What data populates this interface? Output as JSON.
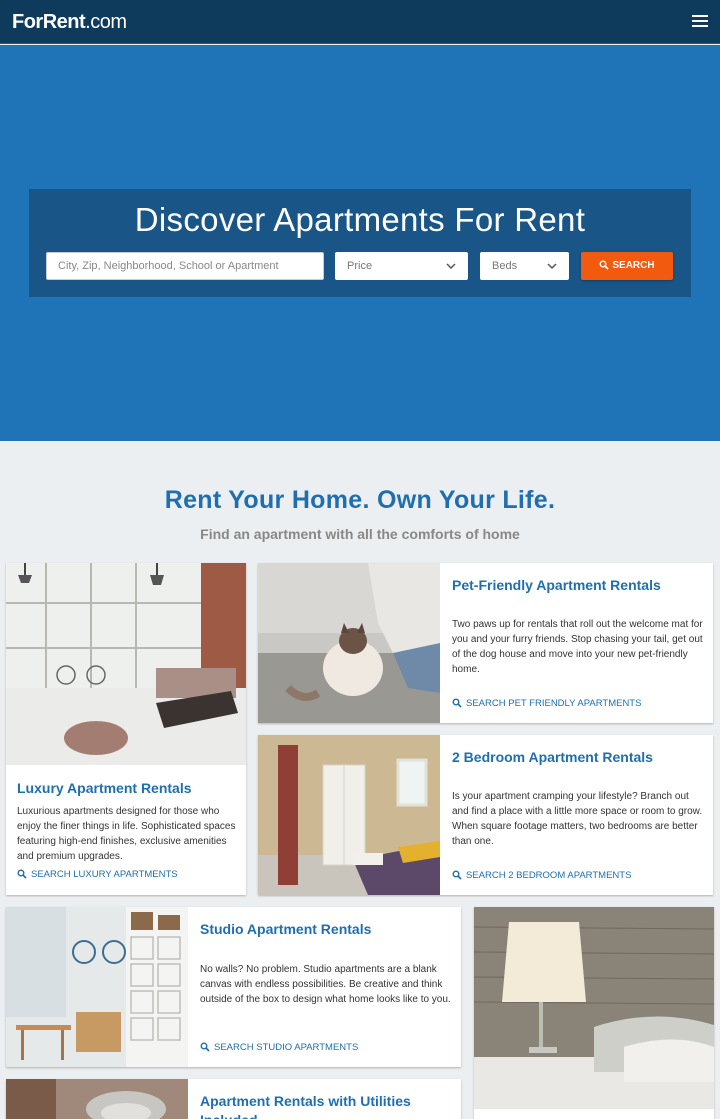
{
  "header": {
    "logo_main": "ForRent",
    "logo_suffix": ".com"
  },
  "hero": {
    "title": "Discover Apartments For Rent",
    "search_placeholder": "City, Zip, Neighborhood, School or Apartment",
    "price_label": "Price",
    "beds_label": "Beds",
    "search_button": "SEARCH"
  },
  "section": {
    "title": "Rent Your Home. Own Your Life.",
    "subtitle": "Find an apartment with all the comforts of home"
  },
  "cards": {
    "luxury": {
      "title": "Luxury Apartment Rentals",
      "desc": "Luxurious apartments designed for those who enjoy the finer things in life. Sophisticated spaces featuring high-end finishes, exclusive amenities and premium upgrades.",
      "link": "SEARCH LUXURY APARTMENTS"
    },
    "pet": {
      "title": "Pet-Friendly Apartment Rentals",
      "desc": "Two paws up for rentals that roll out the welcome mat for you and your furry friends. Stop chasing your tail, get out of the dog house and move into your new pet-friendly home.",
      "link": "SEARCH PET FRIENDLY APARTMENTS"
    },
    "two_bed": {
      "title": "2 Bedroom Apartment Rentals",
      "desc": "Is your apartment cramping your lifestyle? Branch out and find a place with a little more space or room to grow. When square footage matters, two bedrooms are better than one.",
      "link": "SEARCH 2 BEDROOM APARTMENTS"
    },
    "studio": {
      "title": "Studio Apartment Rentals",
      "desc": "No walls? No problem. Studio apartments are a blank canvas with endless possibilities. Be creative and think outside of the box to design what home looks like to you.",
      "link": "SEARCH STUDIO APARTMENTS"
    },
    "utilities": {
      "title": "Apartment Rentals with Utilities Included"
    }
  },
  "colors": {
    "header_bg": "#0e3a5b",
    "hero_bg": "#1f73b7",
    "accent": "#1f6fb0",
    "button": "#f25a0f"
  }
}
